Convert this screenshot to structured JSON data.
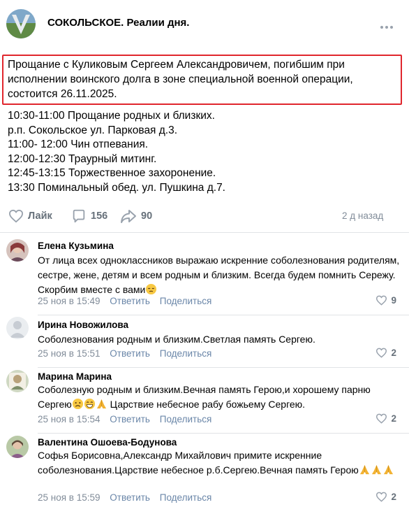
{
  "header": {
    "title": "СОКОЛЬСКОЕ. Реалии дня.",
    "avatar_icon": "group-avatar-icon",
    "more_icon": "more-horizontal-icon"
  },
  "post": {
    "intro": "Прощание с Куликовым Сергеем Александровичем, погибшим при исполнении воинского долга в зоне специальной военной операции, состоится 26.11.2025.",
    "schedule": [
      "10:30-11:00 Прощание родных и близких.",
      "р.п. Сокольское ул. Парковая д.3.",
      "11:00- 12:00 Чин отпевания.",
      "12:00-12:30 Траурный митинг.",
      "12:45-13:15 Торжественное захоронение.",
      "13:30 Поминальный обед. ул. Пушкина д.7."
    ],
    "actions": {
      "like_label": "Лайк",
      "comments_count": "156",
      "shares_count": "90"
    },
    "time": "2 д назад"
  },
  "comments": [
    {
      "author": "Елена Кузьмина",
      "text": "От лица всех одноклассников выражаю искренние соболезнования родителям, сестре, жене, детям и всем родным и близким. Всегда будем помнить Сережу. Скорбим вместе с вами",
      "time": "25 ноя в 15:49",
      "reply": "Ответить",
      "share": "Поделиться",
      "likes": "9"
    },
    {
      "author": "Ирина Новожилова",
      "text": "Соболезнования родным и близким.Светлая память Сергею.",
      "time": "25 ноя в 15:51",
      "reply": "Ответить",
      "share": "Поделиться",
      "likes": "2"
    },
    {
      "author": "Марина Марина",
      "text_a": "Соболезную родным и близким.Вечная память Герою,и хорошему парню Сергею",
      "text_b": " Царствие небесное рабу божьему Сергею.",
      "time": "25 ноя в 15:54",
      "reply": "Ответить",
      "share": "Поделиться",
      "likes": "2"
    },
    {
      "author": "Валентина Ошоева-Бодунова",
      "text": "Софья Борисовна,Александр Михайлович примите искренние соболезнования.Царствие небесное р.б.Сергею.Вечная память Герою",
      "time": "25 ноя в 15:59",
      "reply": "Ответить",
      "share": "Поделиться",
      "likes": "2"
    }
  ],
  "colors": {
    "highlight_border": "#e0262d",
    "link": "#6a86a8",
    "muted": "#818c99",
    "action": "#66707a"
  }
}
